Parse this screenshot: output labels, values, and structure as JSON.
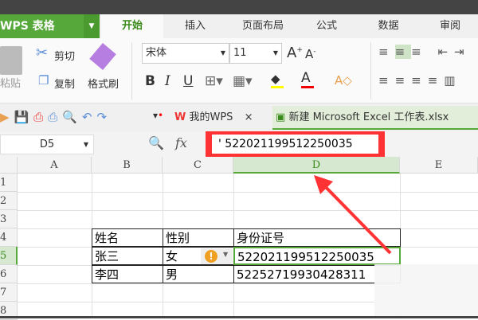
{
  "app": {
    "title": "WPS 表格"
  },
  "menu_tabs": [
    {
      "label": "开始",
      "active": true
    },
    {
      "label": "插入"
    },
    {
      "label": "页面布局"
    },
    {
      "label": "公式"
    },
    {
      "label": "数据"
    },
    {
      "label": "审阅"
    }
  ],
  "ribbon": {
    "paste": "粘贴",
    "cut": "剪切",
    "copy": "复制",
    "format_painter": "格式刷",
    "font_name": "宋体",
    "font_size": "11",
    "bold": "B",
    "italic": "I",
    "underline": "U"
  },
  "doc_tabs": [
    {
      "label": "我的WPS",
      "close": "×"
    },
    {
      "label": "新建 Microsoft Excel 工作表.xlsx",
      "active": true
    }
  ],
  "formula_bar": {
    "name_box": "D5",
    "fx": "fx",
    "value": "' 522021199512250035"
  },
  "sheet": {
    "columns": [
      "A",
      "B",
      "C",
      "D",
      "E"
    ],
    "rows": [
      "1",
      "2",
      "3",
      "4",
      "5",
      "6",
      "7",
      "8"
    ],
    "active_cell": "D5",
    "table": {
      "header": [
        "姓名",
        "性别",
        "身份证号"
      ],
      "rows": [
        [
          "张三",
          "女",
          "522021199512250035"
        ],
        [
          "李四",
          "男",
          "52252719930428311"
        ]
      ]
    }
  },
  "colors": {
    "accent": "#56a83a",
    "highlight": "#ff3333",
    "active_header": "#d6e8d0"
  }
}
